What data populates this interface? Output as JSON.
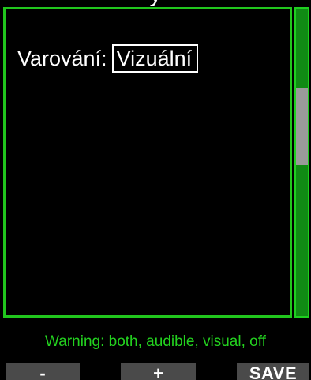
{
  "header": {
    "title": "y"
  },
  "setting": {
    "label": "Varování:",
    "value": "Vizuální"
  },
  "hint": {
    "text": "Warning: both, audible, visual, off"
  },
  "softkeys": {
    "minus": "-",
    "plus": "+",
    "save": "SAVE"
  },
  "scrollbar": {
    "position_fraction": 0.25
  },
  "colors": {
    "accent": "#21c61d",
    "scroll_track": "#108a14",
    "scroll_thumb": "#9a9a9a",
    "softkey_bg": "#4a4a4a",
    "background": "#000000"
  }
}
